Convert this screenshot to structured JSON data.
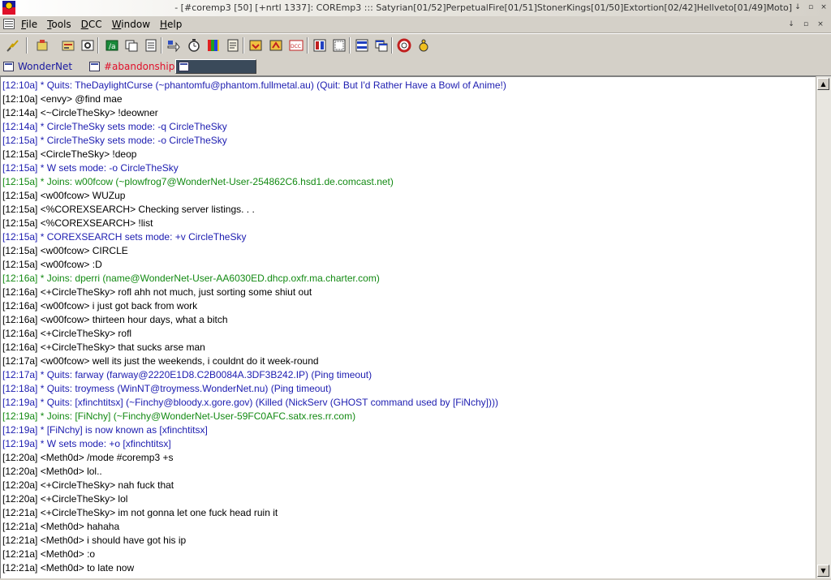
{
  "window": {
    "title": "- [#coremp3 [50] [+nrtl 1337]: COREmp3 ::: Satyrian[01/52]PerpetualFire[01/51]StonerKings[01/50]Extortion[02/42]Hellveto[01/49]Moto]",
    "controls": [
      "↓",
      "▫",
      "×"
    ]
  },
  "menubar": {
    "items": [
      "File",
      "Tools",
      "DCC",
      "Window",
      "Help"
    ],
    "child_controls": [
      "↓",
      "▫",
      "×"
    ]
  },
  "toolbar": {
    "buttons": [
      "connect-icon",
      "options-icon",
      "address-book-icon",
      "channels-icon",
      "script-editor-icon",
      "notify-icon",
      "url-catcher-icon",
      "dcc-send-icon",
      "timer-icon",
      "colors-icon",
      "log-icon",
      "received-files-icon",
      "dcc-chat-icon",
      "dcc-options-icon",
      "tile-icon",
      "cascade-icon",
      "arrange-icon",
      "help-icon",
      "about-icon"
    ]
  },
  "switchbar": {
    "tabs": [
      {
        "label": "WonderNet",
        "color": "#1a1aa0",
        "active": false
      },
      {
        "label": "#abandonship",
        "color": "#e0102a",
        "active": false
      },
      {
        "label": "",
        "color": "#ffffff",
        "active": true
      }
    ]
  },
  "colors": {
    "normal": "#000000",
    "mode": "#1c1cb0",
    "join": "#138a13",
    "quit": "#1c1cb0"
  },
  "chat": {
    "lines": [
      {
        "text": "[12:10a] * Quits: TheDaylightCurse (~phantomfu@phantom.fullmetal.au) (Quit: But I'd Rather Have a Bowl of Anime!)",
        "kind": "quit"
      },
      {
        "text": "[12:10a] <envy> @find mae",
        "kind": "normal"
      },
      {
        "text": "[12:14a] <~CircleTheSky> !deowner",
        "kind": "normal"
      },
      {
        "text": "[12:14a] * CircleTheSky sets mode: -q CircleTheSky",
        "kind": "mode"
      },
      {
        "text": "[12:15a] * CircleTheSky sets mode: -o CircleTheSky",
        "kind": "mode"
      },
      {
        "text": "[12:15a] <CircleTheSky> !deop",
        "kind": "normal"
      },
      {
        "text": "[12:15a] * W sets mode: -o CircleTheSky",
        "kind": "mode"
      },
      {
        "text": "[12:15a] * Joins: w00fcow (~plowfrog7@WonderNet-User-254862C6.hsd1.de.comcast.net)",
        "kind": "join"
      },
      {
        "text": "[12:15a] <w00fcow> WUZup",
        "kind": "normal"
      },
      {
        "text": "[12:15a] <%COREXSEARCH> Checking server listings. . .",
        "kind": "normal"
      },
      {
        "text": "[12:15a] <%COREXSEARCH> !list",
        "kind": "normal"
      },
      {
        "text": "[12:15a] * COREXSEARCH sets mode: +v CircleTheSky",
        "kind": "mode"
      },
      {
        "text": "[12:15a] <w00fcow> CIRCLE",
        "kind": "normal"
      },
      {
        "text": "[12:15a] <w00fcow> :D",
        "kind": "normal"
      },
      {
        "text": "[12:16a] * Joins: dperri (name@WonderNet-User-AA6030ED.dhcp.oxfr.ma.charter.com)",
        "kind": "join"
      },
      {
        "text": "[12:16a] <+CircleTheSky> rofl ahh not much, just sorting some shiut out",
        "kind": "normal"
      },
      {
        "text": "[12:16a] <w00fcow> i just got back from work",
        "kind": "normal"
      },
      {
        "text": "[12:16a] <w00fcow> thirteen hour days, what a bitch",
        "kind": "normal"
      },
      {
        "text": "[12:16a] <+CircleTheSky> rofl",
        "kind": "normal"
      },
      {
        "text": "[12:16a] <+CircleTheSky> that sucks arse man",
        "kind": "normal"
      },
      {
        "text": "[12:17a] <w00fcow> well its just the weekends, i couldnt do it week-round",
        "kind": "normal"
      },
      {
        "text": "[12:17a] * Quits: farway (farway@2220E1D8.C2B0084A.3DF3B242.IP) (Ping timeout)",
        "kind": "quit"
      },
      {
        "text": "[12:18a] * Quits: troymess (WinNT@troymess.WonderNet.nu) (Ping timeout)",
        "kind": "quit"
      },
      {
        "text": "[12:19a] * Quits: [xfinchtitsx] (~Finchy@bloody.x.gore.gov) (Killed (NickServ (GHOST command used by [FiNchy])))",
        "kind": "quit"
      },
      {
        "text": "[12:19a] * Joins: [FiNchy] (~Finchy@WonderNet-User-59FC0AFC.satx.res.rr.com)",
        "kind": "join"
      },
      {
        "text": "[12:19a] * [FiNchy] is now known as [xfinchtitsx]",
        "kind": "mode"
      },
      {
        "text": "[12:19a] * W sets mode: +o [xfinchtitsx]",
        "kind": "mode"
      },
      {
        "text": "[12:20a] <Meth0d> /mode #coremp3 +s",
        "kind": "normal"
      },
      {
        "text": "[12:20a] <Meth0d> lol..",
        "kind": "normal"
      },
      {
        "text": "[12:20a] <+CircleTheSky> nah fuck that",
        "kind": "normal"
      },
      {
        "text": "[12:20a] <+CircleTheSky> lol",
        "kind": "normal"
      },
      {
        "text": "[12:21a] <+CircleTheSky> im not gonna let one fuck head ruin it",
        "kind": "normal"
      },
      {
        "text": "[12:21a] <Meth0d> hahaha",
        "kind": "normal"
      },
      {
        "text": "[12:21a] <Meth0d> i should have got his ip",
        "kind": "normal"
      },
      {
        "text": "[12:21a] <Meth0d> :o",
        "kind": "normal"
      },
      {
        "text": "[12:21a] <Meth0d> to late now",
        "kind": "normal"
      }
    ]
  }
}
